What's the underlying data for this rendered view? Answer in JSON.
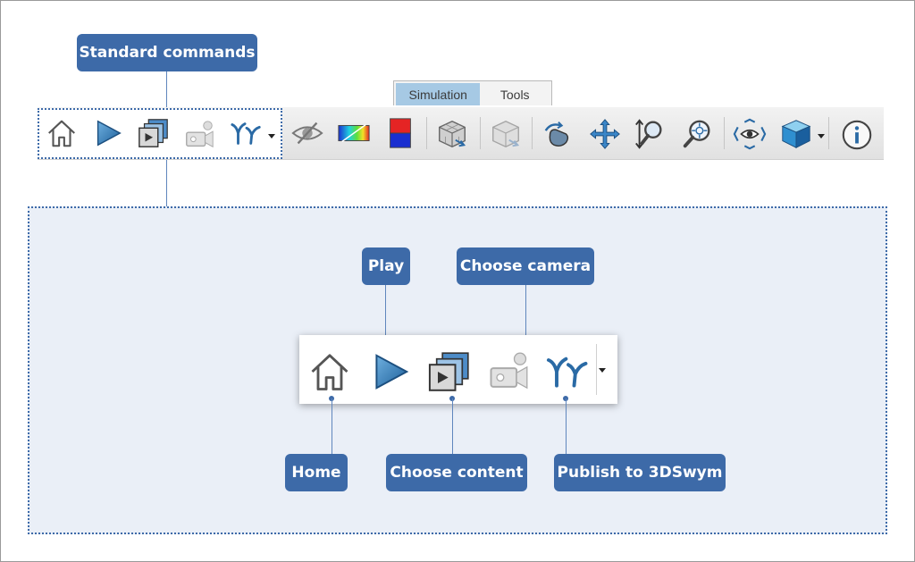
{
  "tabs": [
    {
      "label": "Simulation",
      "active": true
    },
    {
      "label": "Tools",
      "active": false
    }
  ],
  "callouts": {
    "standard_commands": "Standard commands",
    "play": "Play",
    "choose_camera": "Choose camera",
    "home": "Home",
    "choose_content": "Choose content",
    "publish": "Publish to 3DSwym"
  },
  "toolbar_icons": [
    "home-icon",
    "play-icon",
    "choose-content-icon",
    "choose-camera-icon",
    "publish-3dswym-icon",
    "visibility-icon",
    "gradient-icon",
    "color-bar-icon",
    "mesh-cube-icon",
    "mesh-cube-gray-icon",
    "rotate-hand-icon",
    "pan-icon",
    "zoom-icon",
    "zoom-fit-icon",
    "view-eye-icon",
    "view-cube-icon",
    "info-icon"
  ],
  "colors": {
    "callout_bg": "#3d6aa8",
    "panel_bg": "#eaeff7",
    "active_tab": "#a6c9e4"
  }
}
